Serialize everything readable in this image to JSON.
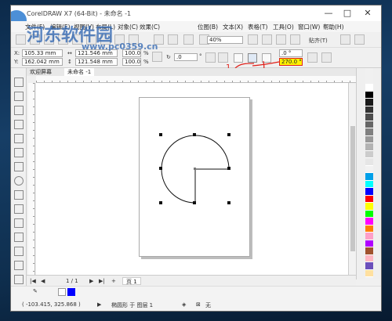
{
  "window": {
    "title": "CorelDRAW X7 (64-Bit) - 未命名 -1"
  },
  "watermark": {
    "text": "河东软件园",
    "url": "www.pc0359.cn"
  },
  "menus": [
    "文件(F)",
    "编辑(E)",
    "视图(V)",
    "布局(L)",
    "对象(C)",
    "效果(C)",
    "位图(B)",
    "文本(X)",
    "表格(T)",
    "工具(O)",
    "窗口(W)",
    "帮助(H)"
  ],
  "toolbar": {
    "zoom": "40%",
    "snap_label": "贴齐(T)"
  },
  "property_bar": {
    "x": "105.33 mm",
    "y": "162.042 mm",
    "w": "121.546 mm",
    "h": "121.548 mm",
    "scale_w": "100.0",
    "scale_h": "100.0",
    "pct": "%",
    "rotation": ".0",
    "degree": "°",
    "start_angle": ".0 °",
    "end_angle": "270.0 °"
  },
  "annotations": {
    "one": "1",
    "two": "2"
  },
  "tabs": [
    "欢迎屏幕",
    "未命名 -1"
  ],
  "pagenav": {
    "pages": "1 / 1",
    "page_tab": "页 1"
  },
  "status": {
    "coords": "( -103.415, 325.868 )",
    "object_info": "椭圆形 于 图层 1",
    "fill": "无"
  },
  "palette": [
    "#ffffff",
    "#000000",
    "#1a1a1a",
    "#333333",
    "#4d4d4d",
    "#666666",
    "#808080",
    "#999999",
    "#b3b3b3",
    "#cccccc",
    "#e6e6e6",
    "#f2f2f2",
    "#00a0e9",
    "#00ffff",
    "#0000ff",
    "#ff0000",
    "#ffff00",
    "#00ff00",
    "#ff00ff",
    "#ff7f00",
    "#ff9fc8",
    "#b000ff",
    "#a0522d",
    "#ffb6c1",
    "#6b4fbb",
    "#ffe0a0"
  ]
}
